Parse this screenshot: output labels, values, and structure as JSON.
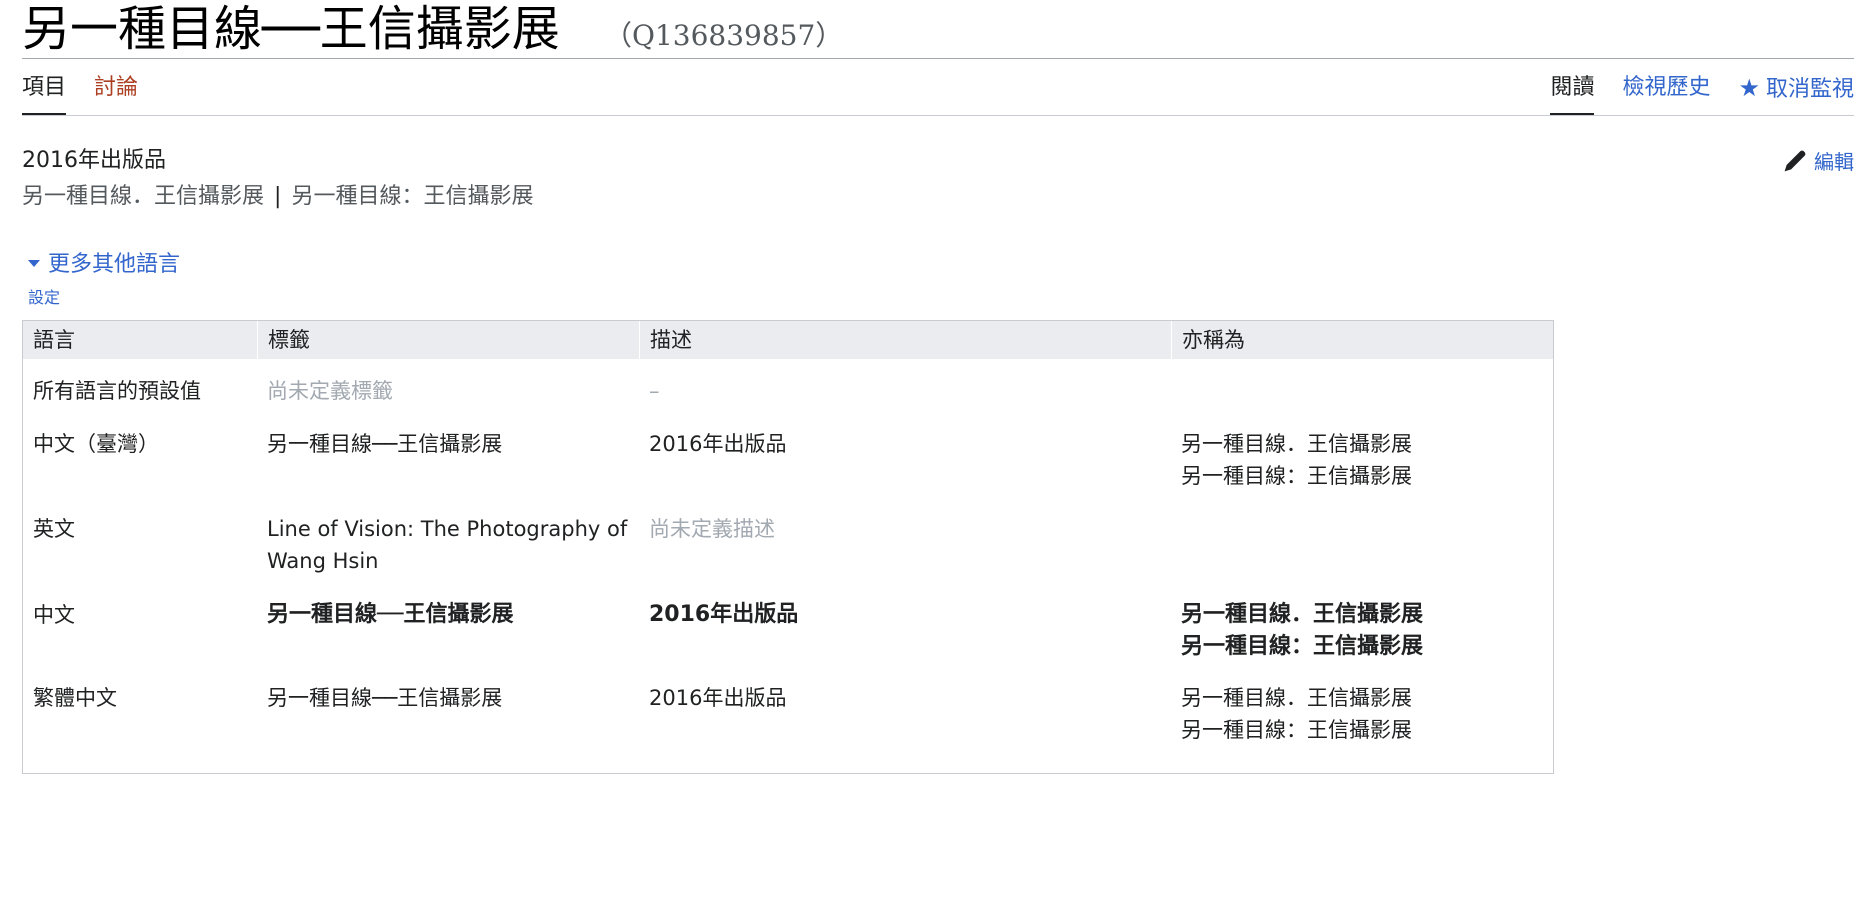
{
  "title": {
    "label": "另一種目線──王信攝影展",
    "id": "（Q136839857）"
  },
  "tabs": {
    "left": [
      {
        "label": "項目",
        "selected": true
      },
      {
        "label": "討論",
        "selected": false
      }
    ],
    "right": [
      {
        "label": "閱讀",
        "selected": true
      },
      {
        "label": "檢視歷史",
        "selected": false
      },
      {
        "label": "取消監視",
        "icon": "star-icon"
      }
    ]
  },
  "header": {
    "description": "2016年出版品",
    "aliases": [
      "另一種目線．王信攝影展",
      "另一種目線：王信攝影展"
    ],
    "alias_separator": "|",
    "edit_label": "編輯"
  },
  "more_languages": {
    "label": "更多其他語言",
    "settings_label": "設定"
  },
  "table": {
    "headers": [
      "語言",
      "標籤",
      "描述",
      "亦稱為"
    ],
    "rows": [
      {
        "language": "所有語言的預設值",
        "label": "尚未定義標籤",
        "description": "–",
        "aliases": []
      },
      {
        "language": "中文（臺灣）",
        "label": "另一種目線──王信攝影展",
        "description": "2016年出版品",
        "aliases": [
          "另一種目線．王信攝影展",
          "另一種目線：王信攝影展"
        ]
      },
      {
        "language": "英文",
        "label": "Line of Vision: The Photography of Wang Hsin",
        "description": "尚未定義描述",
        "aliases": []
      },
      {
        "language": "中文",
        "label": "另一種目線──王信攝影展",
        "description": "2016年出版品",
        "aliases": [
          "另一種目線．王信攝影展",
          "另一種目線：王信攝影展"
        ]
      },
      {
        "language": "繁體中文",
        "label": "另一種目線──王信攝影展",
        "description": "2016年出版品",
        "aliases": [
          "另一種目線．王信攝影展",
          "另一種目線：王信攝影展"
        ]
      }
    ]
  },
  "colors": {
    "link": "#3366cc",
    "new_link": "#ac3f22",
    "muted": "#a2a9b1",
    "header_bg": "#eaecf0"
  }
}
